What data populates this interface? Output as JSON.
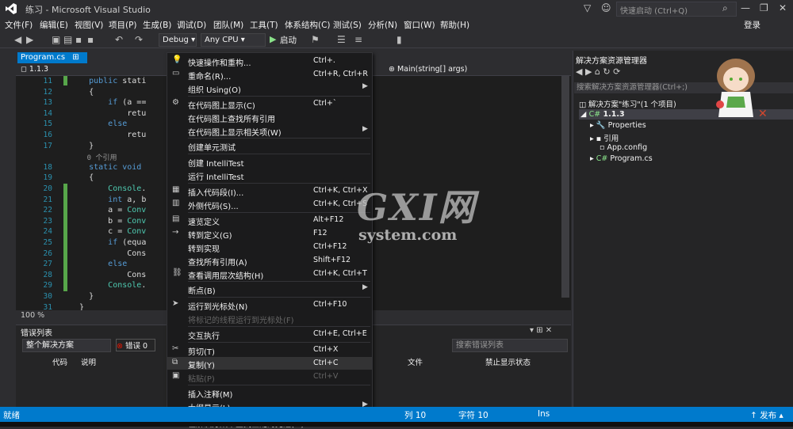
{
  "app": {
    "title": "练习 - Microsoft Visual Studio",
    "quick_launch_placeholder": "快速启动 (Ctrl+Q)",
    "login": "登录"
  },
  "menu": [
    "文件(F)",
    "编辑(E)",
    "视图(V)",
    "项目(P)",
    "生成(B)",
    "调试(D)",
    "团队(M)",
    "工具(T)",
    "体系结构(C)",
    "测试(S)",
    "分析(N)",
    "窗口(W)",
    "帮助(H)"
  ],
  "toolbar": {
    "config": "Debug",
    "platform": "Any CPU",
    "start": "启动"
  },
  "editor": {
    "tab": "Program.cs",
    "nav_left": "1.1.3",
    "nav_right": "Main(string[] args)",
    "zoom": "100 %",
    "lines": [
      {
        "n": "11",
        "t": "    public stati"
      },
      {
        "n": "12",
        "t": "    {"
      },
      {
        "n": "13",
        "t": "        if (a =="
      },
      {
        "n": "14",
        "t": "            retu"
      },
      {
        "n": "15",
        "t": "        else"
      },
      {
        "n": "16",
        "t": "            retu"
      },
      {
        "n": "17",
        "t": "    }"
      },
      {
        "n": "",
        "t": "    0 个引用"
      },
      {
        "n": "18",
        "t": "    static void"
      },
      {
        "n": "19",
        "t": "    {"
      },
      {
        "n": "20",
        "t": "        Console."
      },
      {
        "n": "21",
        "t": "        int a, b"
      },
      {
        "n": "22",
        "t": "        a = Conv"
      },
      {
        "n": "23",
        "t": "        b = Conv"
      },
      {
        "n": "24",
        "t": "        c = Conv"
      },
      {
        "n": "25",
        "t": "        if (equa"
      },
      {
        "n": "26",
        "t": "            Cons"
      },
      {
        "n": "27",
        "t": "        else"
      },
      {
        "n": "28",
        "t": "            Cons"
      },
      {
        "n": "29",
        "t": "        Console."
      },
      {
        "n": "30",
        "t": "    }"
      },
      {
        "n": "31",
        "t": "  }"
      }
    ]
  },
  "error_list": {
    "title": "错误列表",
    "scope": "整个解决方案",
    "errors": "错误 0",
    "search": "搜索错误列表",
    "col_code": "代码",
    "col_desc": "说明",
    "col_file": "文件",
    "col_suppress": "禁止显示状态"
  },
  "solution": {
    "title": "解决方案资源管理器",
    "search": "搜索解决方案资源管理器(Ctrl+;)",
    "root": "解决方案\"练习\"(1 个项目)",
    "project": "1.1.3",
    "items": [
      "Properties",
      "引用",
      "App.config",
      "Program.cs"
    ]
  },
  "context_menu": [
    {
      "label": "快速操作和重构...",
      "shortcut": "Ctrl+.",
      "icon": "lightbulb-icon"
    },
    {
      "label": "重命名(R)...",
      "shortcut": "Ctrl+R, Ctrl+R",
      "icon": "rename-icon"
    },
    {
      "label": "组织 Using(O)",
      "shortcut": "",
      "arrow": true
    },
    {
      "sep": true
    },
    {
      "label": "在代码图上显示(C)",
      "shortcut": "Ctrl+`",
      "icon": "codemap-icon"
    },
    {
      "label": "在代码图上查找所有引用",
      "shortcut": ""
    },
    {
      "label": "在代码图上显示相关项(W)",
      "shortcut": "",
      "arrow": true
    },
    {
      "sep": true
    },
    {
      "label": "创建单元测试",
      "shortcut": ""
    },
    {
      "sep": true
    },
    {
      "label": "创建 IntelliTest",
      "shortcut": ""
    },
    {
      "label": "运行 IntelliTest",
      "shortcut": ""
    },
    {
      "sep": true
    },
    {
      "label": "插入代码段(I)...",
      "shortcut": "Ctrl+K, Ctrl+X",
      "icon": "snippet-icon"
    },
    {
      "label": "外侧代码(S)...",
      "shortcut": "Ctrl+K, Ctrl+S",
      "icon": "surround-icon"
    },
    {
      "sep": true
    },
    {
      "label": "速览定义",
      "shortcut": "Alt+F12",
      "icon": "peek-icon"
    },
    {
      "label": "转到定义(G)",
      "shortcut": "F12",
      "icon": "goto-icon"
    },
    {
      "label": "转到实现",
      "shortcut": "Ctrl+F12"
    },
    {
      "label": "查找所有引用(A)",
      "shortcut": "Shift+F12"
    },
    {
      "label": "查看调用层次结构(H)",
      "shortcut": "Ctrl+K, Ctrl+T",
      "icon": "hierarchy-icon"
    },
    {
      "sep": true
    },
    {
      "label": "断点(B)",
      "shortcut": "",
      "arrow": true
    },
    {
      "sep": true
    },
    {
      "label": "运行到光标处(N)",
      "shortcut": "Ctrl+F10",
      "icon": "cursor-icon"
    },
    {
      "label": "将标记的线程运行到光标处(F)",
      "shortcut": "",
      "disabled": true
    },
    {
      "sep": true
    },
    {
      "label": "交互执行",
      "shortcut": "Ctrl+E, Ctrl+E"
    },
    {
      "sep": true
    },
    {
      "label": "剪切(T)",
      "shortcut": "Ctrl+X",
      "icon": "cut-icon"
    },
    {
      "label": "复制(Y)",
      "shortcut": "Ctrl+C",
      "icon": "copy-icon",
      "hover": true
    },
    {
      "label": "粘贴(P)",
      "shortcut": "Ctrl+V",
      "icon": "paste-icon",
      "disabled": true
    },
    {
      "sep": true
    },
    {
      "label": "插入注释(M)",
      "shortcut": ""
    },
    {
      "label": "大纲显示(L)",
      "shortcut": "",
      "arrow": true
    },
    {
      "sep": true
    },
    {
      "label": "在解决方案中查找匹配的克隆(M)",
      "shortcut": ""
    }
  ],
  "status": {
    "ready": "就绪",
    "col": "列 10",
    "char": "字符 10",
    "ins": "Ins",
    "publish": "发布"
  },
  "watermark": {
    "big": "GXI网",
    "small": "system.com"
  },
  "colors": {
    "accent": "#007acc",
    "bg": "#2d2d30",
    "editor": "#1e1e1e"
  }
}
